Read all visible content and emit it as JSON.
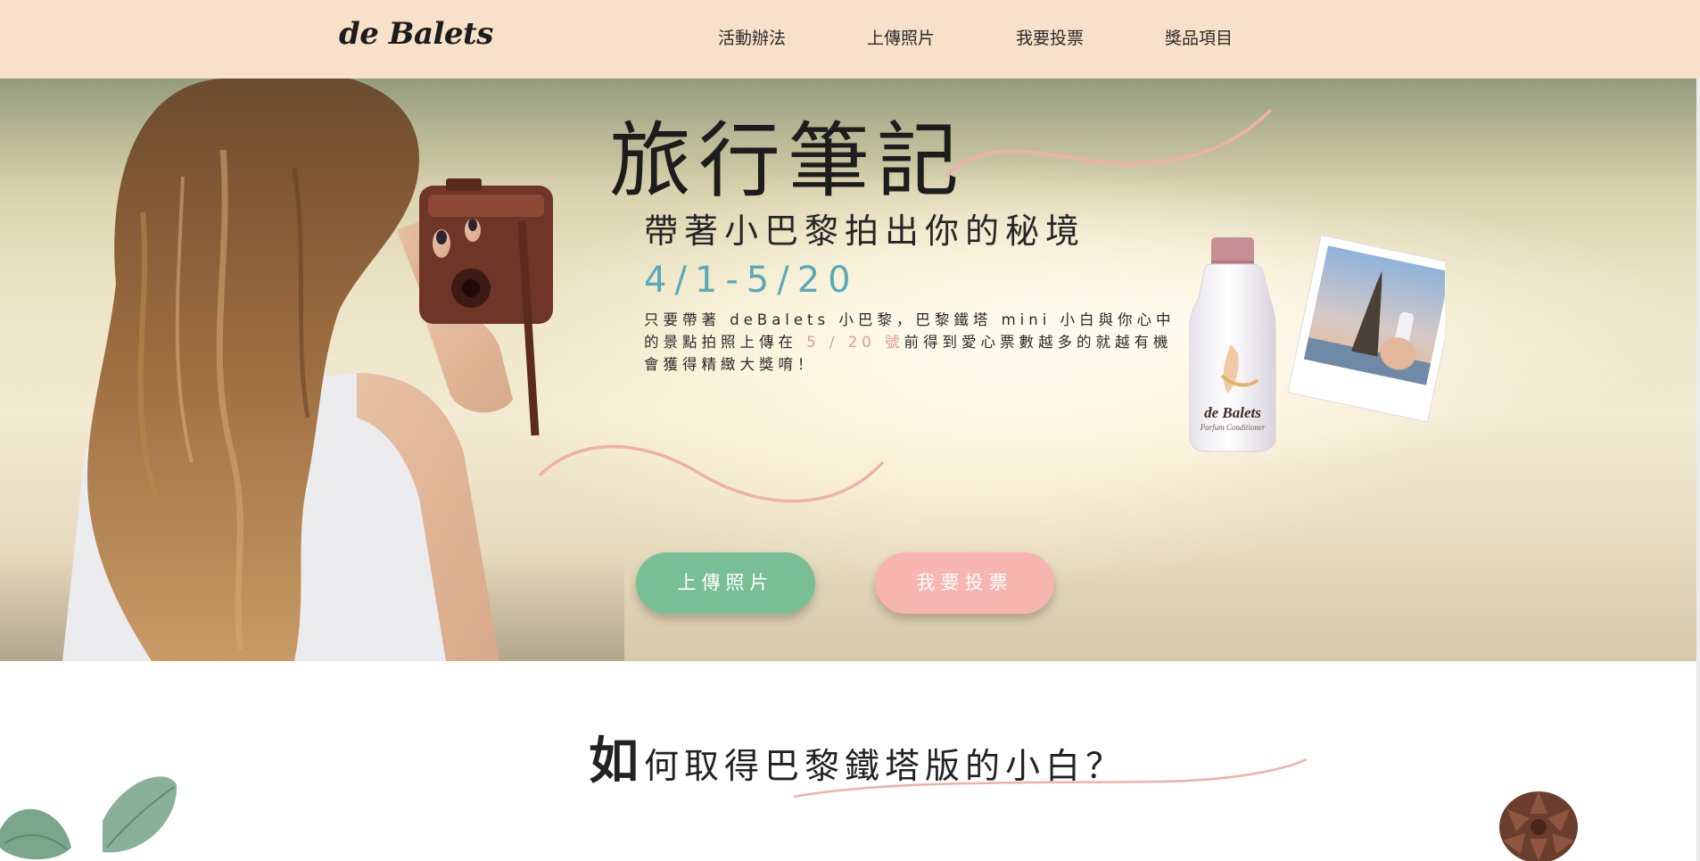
{
  "header": {
    "logo": "de Balets",
    "nav": [
      "活動辦法",
      "上傳照片",
      "我要投票",
      "獎品項目"
    ]
  },
  "hero": {
    "title": "旅行筆記",
    "subtitle": "帶著小巴黎拍出你的秘境",
    "date_range": "4/1-5/20",
    "description_part1": "只要帶著 deBalets 小巴黎，巴黎鐵塔 mini 小白與你心中的景點拍照上傳在 ",
    "description_highlight": "5 / 20 號",
    "description_part2": "前得到愛心票數越多的就越有機會獲得精緻大獎唷！",
    "upload_button": "上傳照片",
    "vote_button": "我要投票",
    "product_label_brand": "de Balets",
    "product_label_sub": "Parfum Conditioner"
  },
  "section": {
    "title_first_char": "如",
    "title_rest": "何取得巴黎鐵塔版的小白？"
  },
  "colors": {
    "header_bg": "#f7e1c9",
    "upload_green": "#79bf95",
    "vote_pink": "#f7b5b1",
    "date_teal": "#5aa9b7",
    "highlight_pink": "#e29b93",
    "swoosh": "#f0b0a6"
  },
  "icons": [
    "product-bottle-icon",
    "eiffel-photo-icon",
    "eucalyptus-leaf-icon",
    "pine-cone-icon"
  ]
}
